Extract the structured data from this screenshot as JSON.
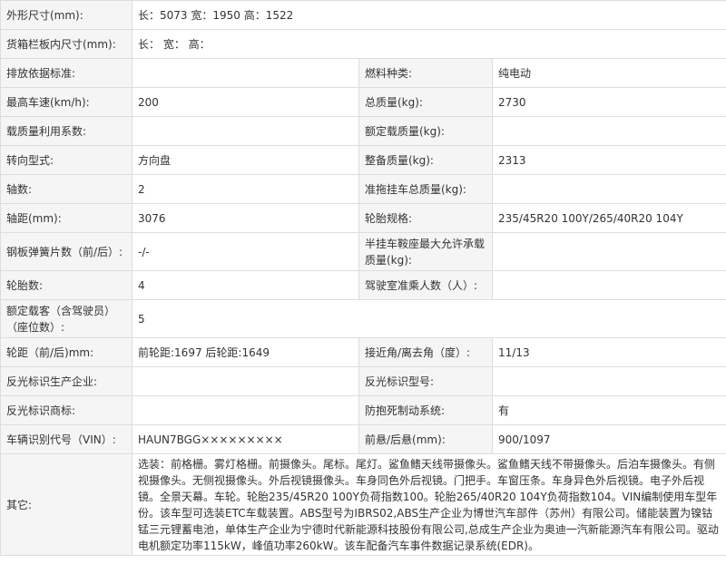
{
  "rows": [
    {
      "l1": "外形尺寸(mm):",
      "v1": "长：5073 宽：1950 高：1522"
    },
    {
      "l1": "货箱栏板内尺寸(mm):",
      "v1": "长： 宽： 高："
    },
    {
      "l1": "排放依据标准:",
      "v1": "",
      "l2": "燃料种类:",
      "v2": "纯电动"
    },
    {
      "l1": "最高车速(km/h):",
      "v1": "200",
      "l2": "总质量(kg):",
      "v2": "2730"
    },
    {
      "l1": "载质量利用系数:",
      "v1": "",
      "l2": "额定载质量(kg):",
      "v2": ""
    },
    {
      "l1": "转向型式:",
      "v1": "方向盘",
      "l2": "整备质量(kg):",
      "v2": "2313"
    },
    {
      "l1": "轴数:",
      "v1": "2",
      "l2": "准拖挂车总质量(kg):",
      "v2": ""
    },
    {
      "l1": "轴距(mm):",
      "v1": "3076",
      "l2": "轮胎规格:",
      "v2": "235/45R20 100Y/265/40R20 104Y"
    },
    {
      "l1": "钢板弹簧片数（前/后）:",
      "v1": "-/-",
      "l2": "半挂车鞍座最大允许承载质量(kg):",
      "v2": ""
    },
    {
      "l1": "轮胎数:",
      "v1": "4",
      "l2": "驾驶室准乘人数（人）:",
      "v2": ""
    },
    {
      "l1": "额定载客（含驾驶员）（座位数）:",
      "v1": "5"
    },
    {
      "l1": "轮距（前/后)mm:",
      "v1": "前轮距:1697 后轮距:1649",
      "l2": "接近角/离去角（度）:",
      "v2": "11/13"
    },
    {
      "l1": "反光标识生产企业:",
      "v1": "",
      "l2": "反光标识型号:",
      "v2": ""
    },
    {
      "l1": "反光标识商标:",
      "v1": "",
      "l2": "防抱死制动系统:",
      "v2": "有"
    },
    {
      "l1": "车辆识别代号（VIN）:",
      "v1": "HAUN7BGG×××××××××",
      "l2": "前悬/后悬(mm):",
      "v2": "900/1097"
    }
  ],
  "other": {
    "label": "其它:",
    "text": "选装：前格栅。雾灯格栅。前摄像头。尾标。尾灯。鲨鱼鳍天线带摄像头。鲨鱼鳍天线不带摄像头。后泊车摄像头。有侧视摄像头。无侧视摄像头。外后视镜摄像头。车身同色外后视镜。门把手。车窗压条。车身异色外后视镜。电子外后视镜。全景天幕。车轮。轮胎235/45R20 100Y负荷指数100。轮胎265/40R20 104Y负荷指数104。VIN编制使用车型年份。该车型可选装ETC车载装置。ABS型号为IBRS02,ABS生产企业为博世汽车部件（苏州）有限公司。储能装置为镍钴锰三元锂蓄电池，单体生产企业为宁德时代新能源科技股份有限公司,总成生产企业为奥迪一汽新能源汽车有限公司。驱动电机额定功率115kW，峰值功率260kW。该车配备汽车事件数据记录系统(EDR)。"
  }
}
